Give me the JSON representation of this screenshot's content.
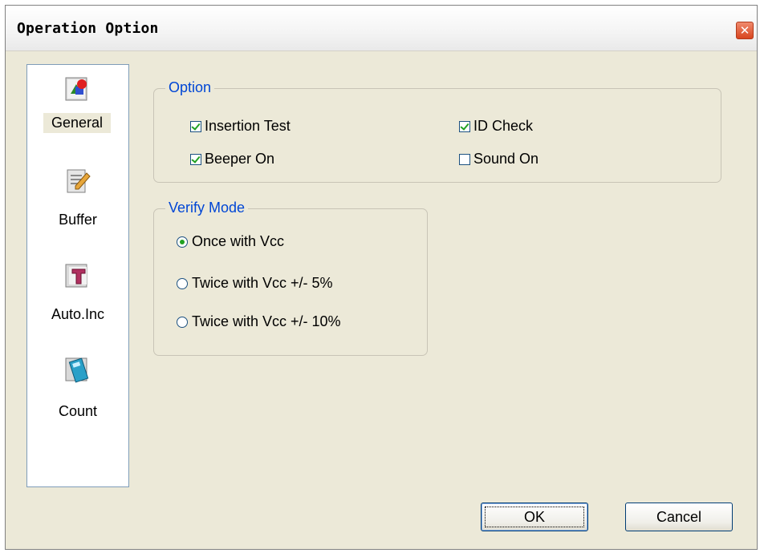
{
  "window": {
    "title": "Operation Option"
  },
  "sidebar": {
    "items": [
      {
        "label": "General",
        "icon": "general-icon",
        "active": true
      },
      {
        "label": "Buffer",
        "icon": "buffer-icon",
        "active": false
      },
      {
        "label": "Auto.Inc",
        "icon": "auto-inc-icon",
        "active": false
      },
      {
        "label": "Count",
        "icon": "count-icon",
        "active": false
      }
    ]
  },
  "option_group": {
    "title": "Option",
    "insertion_test": {
      "label": "Insertion Test",
      "checked": true
    },
    "id_check": {
      "label": "ID Check",
      "checked": true
    },
    "beeper_on": {
      "label": "Beeper On",
      "checked": true
    },
    "sound_on": {
      "label": "Sound On",
      "checked": false
    }
  },
  "verify_group": {
    "title": "Verify Mode",
    "options": [
      {
        "label": "Once with Vcc",
        "selected": true
      },
      {
        "label": "Twice with Vcc +/- 5%",
        "selected": false
      },
      {
        "label": "Twice with Vcc +/- 10%",
        "selected": false
      }
    ]
  },
  "buttons": {
    "ok": "OK",
    "cancel": "Cancel"
  },
  "colors": {
    "group_title": "#0046d5",
    "check_mark": "#21a121",
    "close_button": "#d8451f",
    "face": "#ece9d8"
  }
}
